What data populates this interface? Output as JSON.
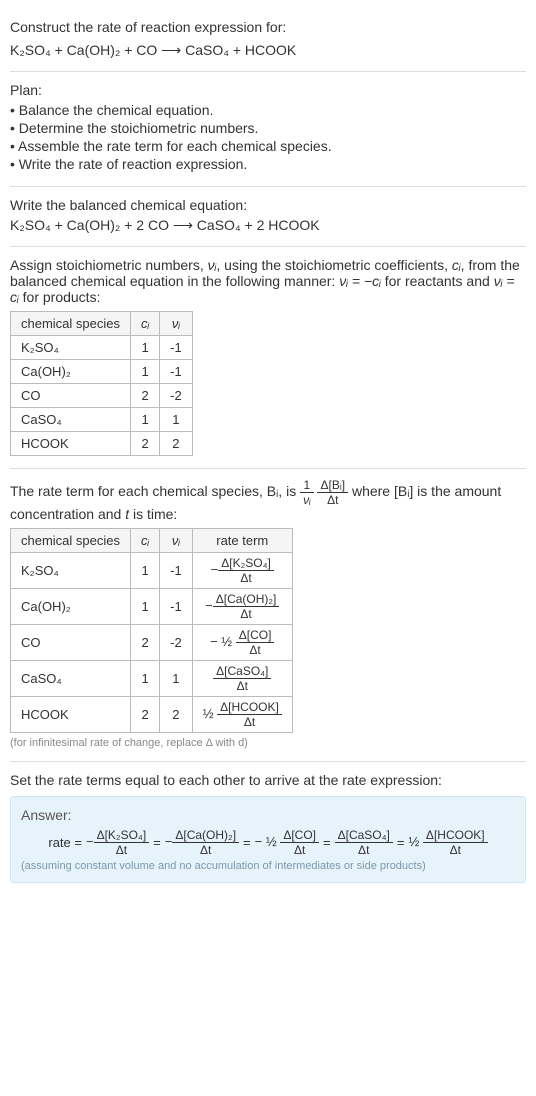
{
  "header": {
    "prompt": "Construct the rate of reaction expression for:",
    "equation": "K₂SO₄ + Ca(OH)₂ + CO ⟶ CaSO₄ + HCOOK"
  },
  "plan": {
    "title": "Plan:",
    "items": [
      "Balance the chemical equation.",
      "Determine the stoichiometric numbers.",
      "Assemble the rate term for each chemical species.",
      "Write the rate of reaction expression."
    ]
  },
  "balanced": {
    "title": "Write the balanced chemical equation:",
    "equation": "K₂SO₄ + Ca(OH)₂ + 2 CO ⟶ CaSO₄ + 2 HCOOK"
  },
  "assign": {
    "text_a": "Assign stoichiometric numbers, ",
    "nu_i": "νᵢ",
    "text_b": ", using the stoichiometric coefficients, ",
    "c_i": "cᵢ",
    "text_c": ", from the balanced chemical equation in the following manner: ",
    "rel1": "νᵢ = −cᵢ",
    "text_d": " for reactants and ",
    "rel2": "νᵢ = cᵢ",
    "text_e": " for products:",
    "headers": {
      "species": "chemical species",
      "c": "cᵢ",
      "nu": "νᵢ"
    },
    "rows": [
      {
        "sp": "K₂SO₄",
        "c": "1",
        "nu": "-1"
      },
      {
        "sp": "Ca(OH)₂",
        "c": "1",
        "nu": "-1"
      },
      {
        "sp": "CO",
        "c": "2",
        "nu": "-2"
      },
      {
        "sp": "CaSO₄",
        "c": "1",
        "nu": "1"
      },
      {
        "sp": "HCOOK",
        "c": "2",
        "nu": "2"
      }
    ]
  },
  "rateterm": {
    "text_a": "The rate term for each chemical species, Bᵢ, is ",
    "frac1_num": "1",
    "frac1_den": "νᵢ",
    "frac2_num": "Δ[Bᵢ]",
    "frac2_den": "Δt",
    "text_b": " where [Bᵢ] is the amount concentration and ",
    "t": "t",
    "text_c": " is time:",
    "headers": {
      "species": "chemical species",
      "c": "cᵢ",
      "nu": "νᵢ",
      "rt": "rate term"
    },
    "rows": [
      {
        "sp": "K₂SO₄",
        "c": "1",
        "nu": "-1",
        "pre": "−",
        "num": "Δ[K₂SO₄]",
        "den": "Δt"
      },
      {
        "sp": "Ca(OH)₂",
        "c": "1",
        "nu": "-1",
        "pre": "−",
        "num": "Δ[Ca(OH)₂]",
        "den": "Δt"
      },
      {
        "sp": "CO",
        "c": "2",
        "nu": "-2",
        "pre": "− ½ ",
        "num": "Δ[CO]",
        "den": "Δt"
      },
      {
        "sp": "CaSO₄",
        "c": "1",
        "nu": "1",
        "pre": "",
        "num": "Δ[CaSO₄]",
        "den": "Δt"
      },
      {
        "sp": "HCOOK",
        "c": "2",
        "nu": "2",
        "pre": "½ ",
        "num": "Δ[HCOOK]",
        "den": "Δt"
      }
    ],
    "hint": "(for infinitesimal rate of change, replace Δ with d)"
  },
  "final": {
    "intro": "Set the rate terms equal to each other to arrive at the rate expression:",
    "answer_label": "Answer:",
    "lead": "rate = ",
    "eq": " = ",
    "terms": [
      {
        "pre": "−",
        "num": "Δ[K₂SO₄]",
        "den": "Δt"
      },
      {
        "pre": "−",
        "num": "Δ[Ca(OH)₂]",
        "den": "Δt"
      },
      {
        "pre": "− ½ ",
        "num": "Δ[CO]",
        "den": "Δt"
      },
      {
        "pre": "",
        "num": "Δ[CaSO₄]",
        "den": "Δt"
      },
      {
        "pre": "½ ",
        "num": "Δ[HCOOK]",
        "den": "Δt"
      }
    ],
    "hint": "(assuming constant volume and no accumulation of intermediates or side products)"
  }
}
